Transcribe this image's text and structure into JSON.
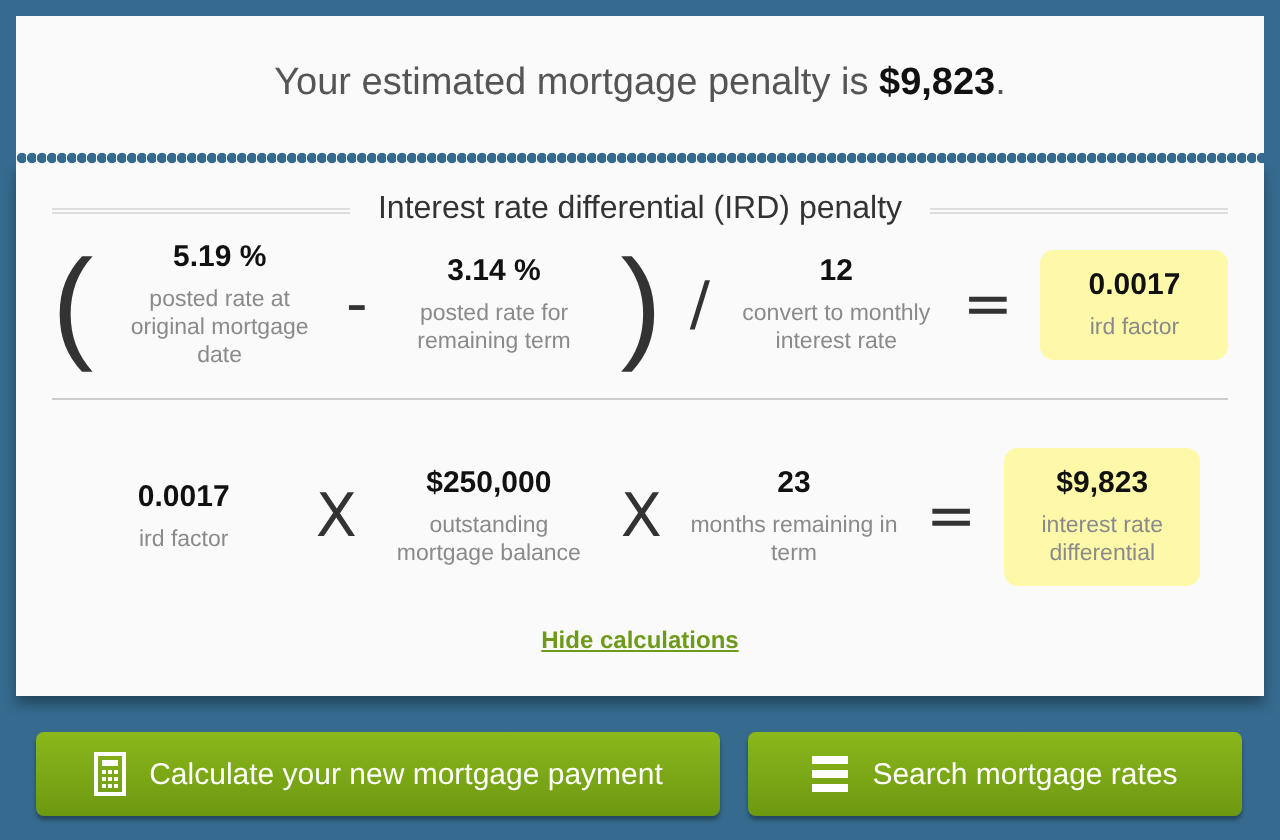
{
  "headline": "Your estimated mortgage penalty is **$9,823**.",
  "section_title": "Interest rate differential (IRD) penalty",
  "equations": [
    {
      "items": [
        {
          "kind": "paren",
          "text": "("
        },
        {
          "kind": "term",
          "value": "5.19 %",
          "caption": "posted rate at original mortgage date"
        },
        {
          "kind": "operator",
          "text": "-"
        },
        {
          "kind": "term",
          "value": "3.14 %",
          "caption": "posted rate for remaining term"
        },
        {
          "kind": "paren",
          "text": ")"
        },
        {
          "kind": "operator",
          "text": "/"
        },
        {
          "kind": "term",
          "value": "12",
          "caption": "convert to monthly interest rate"
        },
        {
          "kind": "operator",
          "text": "="
        },
        {
          "kind": "result",
          "value": "0.0017",
          "caption": "ird factor"
        }
      ]
    },
    {
      "items": [
        {
          "kind": "term",
          "value": "0.0017",
          "caption": "ird factor"
        },
        {
          "kind": "operator",
          "text": "X"
        },
        {
          "kind": "term",
          "value": "$250,000",
          "caption": "outstanding mortgage balance"
        },
        {
          "kind": "operator",
          "text": "X"
        },
        {
          "kind": "term",
          "value": "23",
          "caption": "months remaining in term"
        },
        {
          "kind": "operator",
          "text": "="
        },
        {
          "kind": "result",
          "value": "$9,823",
          "caption": "interest rate differential"
        }
      ]
    }
  ],
  "link": "Hide calculations",
  "buttons": [
    {
      "label": "Calculate your new mortgage payment",
      "kind": "calculator"
    },
    {
      "label": "Search mortgage rates",
      "kind": "list"
    }
  ]
}
